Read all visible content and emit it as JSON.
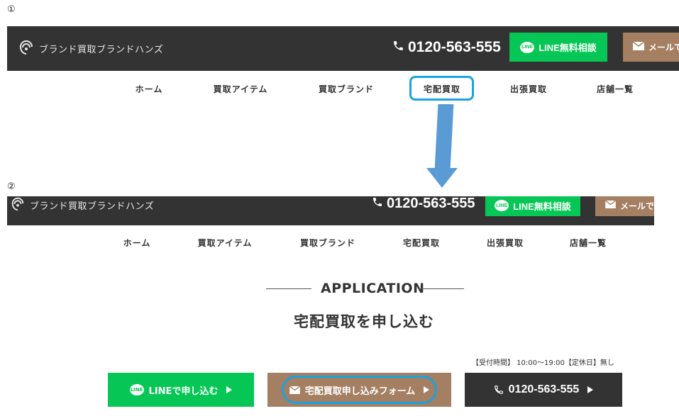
{
  "steps": {
    "one": "①",
    "two": "②"
  },
  "header": {
    "logo_text": "ブランド買取ブランドハンズ",
    "phone": "0120-563-555",
    "line_label": "LINE無料相談",
    "line_badge": "LINE",
    "mail_label": "メールで"
  },
  "nav": {
    "items": [
      "ホーム",
      "買取アイテム",
      "買取ブランド",
      "宅配買取",
      "出張買取",
      "店舗一覧"
    ]
  },
  "section": {
    "title": "APPLICATION",
    "subtitle": "宅配買取を申し込む",
    "hours": "【受付時間】 10:00〜19:00【定休日】無し"
  },
  "cta": {
    "line_label": "LINEで申し込む",
    "line_badge": "LINE",
    "mail_label": "宅配買取申し込みフォーム",
    "phone_label": "0120-563-555"
  },
  "colors": {
    "header_bg": "#333333",
    "line_green": "#06c755",
    "mail_brown": "#a47f62",
    "highlight_blue": "#1aa3e0",
    "arrow_blue": "#5b9bd5"
  },
  "icons": {
    "logo": "wifi-swirl-logo-icon",
    "phone": "phone-icon",
    "mail": "envelope-icon",
    "play": "play-triangle-icon"
  }
}
